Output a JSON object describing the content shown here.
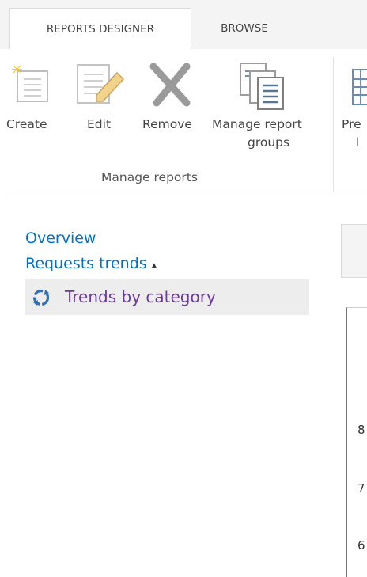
{
  "tabs": [
    {
      "label": "REPORTS DESIGNER",
      "active": true
    },
    {
      "label": "BROWSE",
      "active": false
    }
  ],
  "ribbon": {
    "group_label": "Manage reports",
    "buttons": [
      {
        "label": "Create",
        "icon": "create-report-icon"
      },
      {
        "label": "Edit",
        "icon": "edit-report-icon"
      },
      {
        "label": "Remove",
        "icon": "remove-icon"
      },
      {
        "label_line1": "Manage report",
        "label_line2": "groups",
        "icon": "manage-groups-icon"
      },
      {
        "label_line1": "Pre",
        "label_line2": "l",
        "icon": "preview-icon"
      }
    ]
  },
  "nav": {
    "overview": "Overview",
    "requests_trends": "Requests trends",
    "sort_icon": "▲▼",
    "selected": "Trends by category"
  },
  "chart_ticks": [
    "8",
    "7",
    "6"
  ],
  "colors": {
    "link": "#0072c6",
    "selected_text": "#6b3a9d",
    "selected_bg": "#ededed"
  }
}
